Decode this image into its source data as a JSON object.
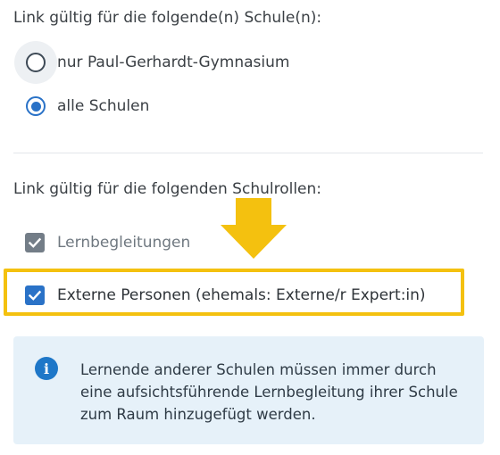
{
  "schools_section": {
    "heading": "Link gültig für die folgende(n) Schule(n):",
    "options": [
      {
        "label": "nur Paul-Gerhardt-Gymnasium",
        "selected": false
      },
      {
        "label": "alle Schulen",
        "selected": true
      }
    ]
  },
  "roles_section": {
    "heading": "Link gültig für die folgenden Schulrollen:",
    "options": [
      {
        "label": "Lernbegleitungen",
        "checked": true,
        "disabled": true
      },
      {
        "label": "Externe Personen (ehemals: Externe/r Expert:in)",
        "checked": true,
        "disabled": false
      }
    ]
  },
  "info_alert": {
    "icon": "info-icon",
    "icon_glyph": "i",
    "text": "Lernende anderer Schulen müssen immer durch eine aufsichtsführende Lernbegleitung ihrer Schule zum Raum hinzugefügt werden."
  },
  "colors": {
    "primary": "#2a72c7",
    "highlight": "#f4c10f",
    "info_background": "#e6f1f9"
  }
}
